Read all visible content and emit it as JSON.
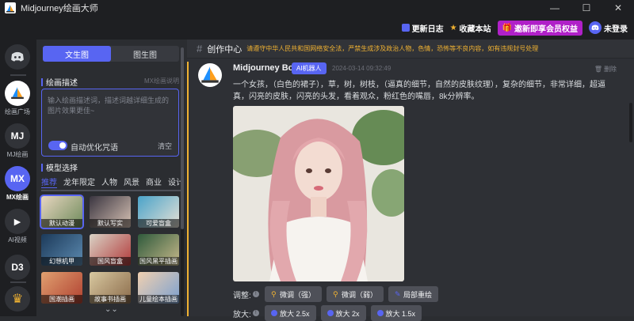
{
  "window": {
    "title": "Midjourney绘画大师",
    "minimize": "—",
    "maximize": "☐",
    "close": "✕"
  },
  "topbar": {
    "changelog": "更新日志",
    "bookmark": "收藏本站",
    "vip": "邀新即享会员权益",
    "login": "未登录"
  },
  "rail": {
    "items": [
      {
        "label": "绘画广场",
        "glyph": ""
      },
      {
        "label": "MJ绘画",
        "glyph": "MJ"
      },
      {
        "label": "MX绘画",
        "glyph": "MX"
      },
      {
        "label": "AI视频",
        "glyph": "▶"
      },
      {
        "label": "",
        "glyph": "D3"
      },
      {
        "label": "",
        "glyph": "♛"
      }
    ]
  },
  "panel": {
    "tabs": [
      "文生图",
      "图生图"
    ],
    "active_tab": 0,
    "prompt_section": "绘画描述",
    "prompt_hint": "MX绘画说明",
    "prompt_placeholder": "输入绘画描述词，描述词越详细生成的图片效果更佳~",
    "auto_optimize": "自动优化咒语",
    "clear": "清空",
    "model_section": "模型选择",
    "categories": [
      "推荐",
      "龙年限定",
      "人物",
      "风景",
      "商业",
      "设计"
    ],
    "active_category": 0,
    "models": [
      {
        "name": "默认动漫",
        "colors": [
          "#e8d6c0",
          "#6d8a5a"
        ]
      },
      {
        "name": "默认写实",
        "colors": [
          "#3a3540",
          "#d8c3b5"
        ]
      },
      {
        "name": "可爱盲盒",
        "colors": [
          "#4aa3c9",
          "#e7e1d6"
        ]
      },
      {
        "name": "幻想机甲",
        "colors": [
          "#1c3a5a",
          "#5c8ab0"
        ]
      },
      {
        "name": "国风盲盒",
        "colors": [
          "#d9d2c5",
          "#b23a3a"
        ]
      },
      {
        "name": "国风黑平插画",
        "colors": [
          "#2f5a3c",
          "#c7b98a"
        ]
      },
      {
        "name": "国潮插画",
        "colors": [
          "#e0a070",
          "#b04030"
        ]
      },
      {
        "name": "故事书插画",
        "colors": [
          "#d8c8a0",
          "#8a6a4a"
        ]
      },
      {
        "name": "儿童绘本插画",
        "colors": [
          "#f0d0b0",
          "#7aa0d0"
        ]
      }
    ]
  },
  "main": {
    "channel": "创作中心",
    "notice": "请遵守中华人民共和国网络安全法，严禁生成涉及政治人物，色情，恐怖等不良内容，如有违规封号处理",
    "message": {
      "author": "Midjourney Bot",
      "badge": "AI机器人",
      "time": "2024-03-14 09:32:49",
      "delete": "删除",
      "text": "一个女孩，（白色的裙子），草，树，树枝，（逼真的细节，自然的皮肤纹理），复杂的细节，非常详细，超逼真，闪亮的皮肤，闪亮的头发，看着观众，粉红色的嘴唇，8k分辨率。"
    },
    "adjust_label": "调整:",
    "adjust_buttons": [
      "微调（强）",
      "微调（弱）",
      "局部重绘"
    ],
    "zoom_label": "放大:",
    "zoom_buttons": [
      "放大 2.5x",
      "放大 2x",
      "放大 1.5x"
    ]
  },
  "colors": {
    "accent": "#5865f2",
    "warning": "#f0b232",
    "vip": "#b020c8"
  }
}
